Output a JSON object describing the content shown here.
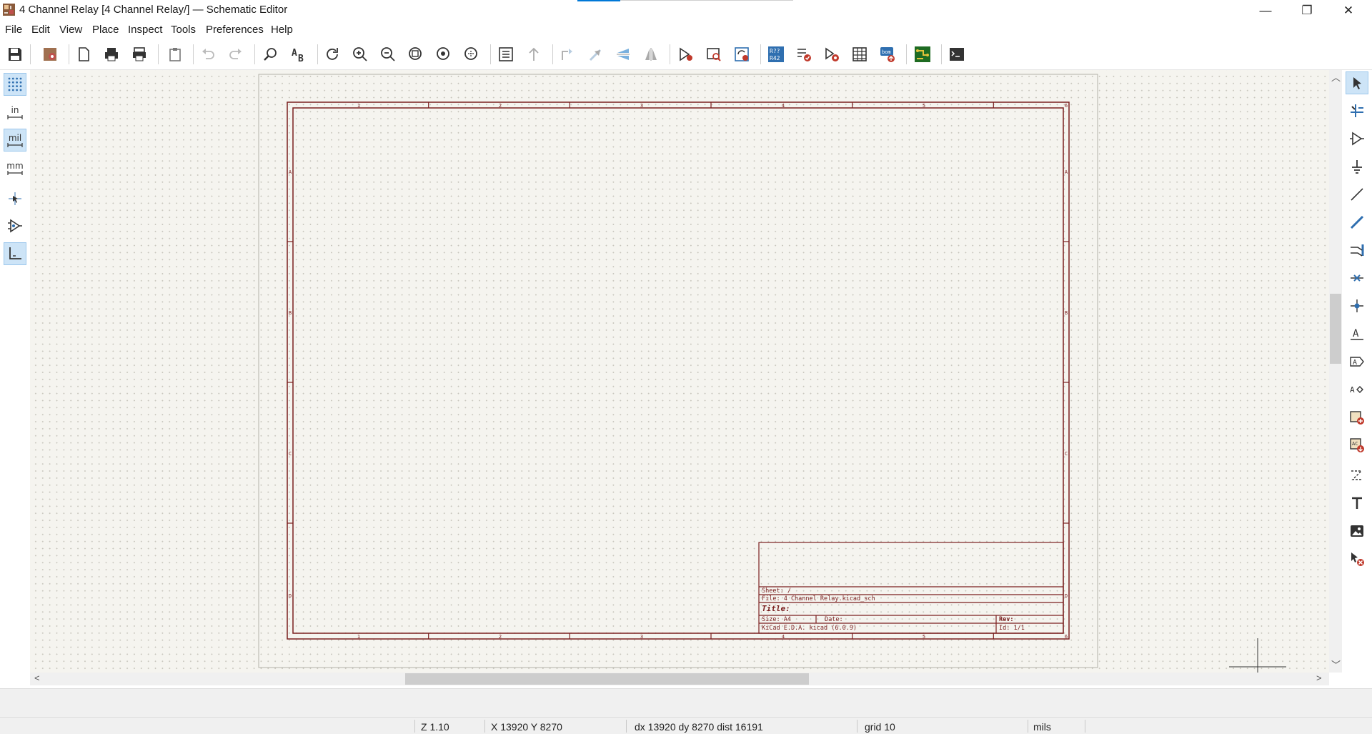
{
  "window": {
    "title": "4 Channel Relay [4 Channel Relay/] — Schematic Editor",
    "minimize_glyph": "—",
    "restore_glyph": "❐",
    "close_glyph": "✕"
  },
  "menu": {
    "items": [
      "File",
      "Edit",
      "View",
      "Place",
      "Inspect",
      "Tools",
      "Preferences",
      "Help"
    ]
  },
  "toolbar": {
    "icons": [
      "save-icon",
      "schematic-setup-icon",
      "page-settings-icon",
      "print-icon",
      "plot-icon",
      "paste-icon",
      "undo-icon",
      "redo-icon",
      "find-icon",
      "find-replace-icon",
      "refresh-icon",
      "zoom-in-icon",
      "zoom-out-icon",
      "zoom-fit-icon",
      "zoom-objects-icon",
      "zoom-selection-icon",
      "hierarchy-navigator-icon",
      "leave-sheet-icon",
      "rotate-ccw-icon",
      "rotate-cw-icon",
      "mirror-horizontal-icon",
      "mirror-vertical-icon",
      "symbol-editor-icon",
      "symbol-browser-icon",
      "update-from-library-icon",
      "annotate-icon",
      "erc-icon",
      "footprint-assign-icon",
      "symbol-fields-table-icon",
      "bom-icon",
      "pcb-editor-icon",
      "scripting-console-icon"
    ]
  },
  "left_toolbar": {
    "units_in": "in",
    "units_mil": "mil",
    "units_mm": "mm"
  },
  "right_toolbar": {
    "icons": [
      "select-arrow-icon",
      "highlight-net-icon",
      "add-symbol-icon",
      "add-power-icon",
      "add-wire-icon",
      "add-bus-icon",
      "add-bus-entry-icon",
      "no-connect-icon",
      "add-junction-icon",
      "add-label-icon",
      "add-global-label-icon",
      "add-hierarchical-label-icon",
      "add-sheet-icon",
      "import-sheet-pin-icon",
      "add-graphic-line-icon",
      "add-text-icon",
      "add-image-icon",
      "delete-tool-icon"
    ]
  },
  "sheet": {
    "col_labels": [
      "1",
      "2",
      "3",
      "4",
      "5",
      "6"
    ],
    "row_labels": [
      "A",
      "B",
      "C",
      "D"
    ],
    "title_block": {
      "sheet": "Sheet: /",
      "file": "File: 4 Channel Relay.kicad_sch",
      "title": "Title:",
      "size": "Size: A4",
      "date": "Date:",
      "rev": "Rev:",
      "generator": "KiCad E.D.A.  kicad (6.0.9)",
      "id": "Id: 1/1"
    }
  },
  "scrollbars": {
    "up": "︿",
    "down": "﹀",
    "left": "<",
    "right": ">"
  },
  "status": {
    "zoom": "Z 1.10",
    "cursor": "X 13920  Y 8270",
    "delta": "dx 13920  dy 8270  dist 16191",
    "grid": "grid 10",
    "units": "mils"
  },
  "colors": {
    "sheet_border": "#7a1f1f",
    "canvas_bg": "#f5f4ef",
    "accent": "#0078d7"
  }
}
